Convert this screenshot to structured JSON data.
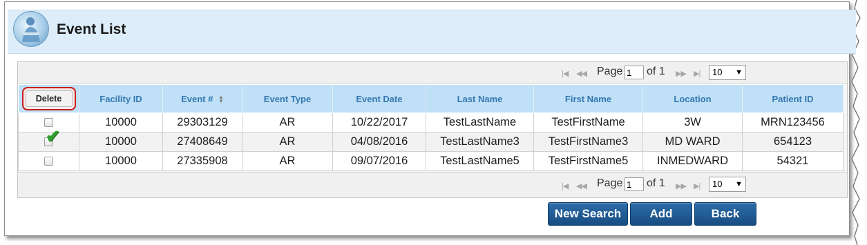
{
  "header": {
    "title": "Event List",
    "logo_icon": "clinician-icon"
  },
  "grid": {
    "pager": {
      "page_label": "Page",
      "page_value": "1",
      "of_label": "of 1",
      "page_size": "10"
    },
    "delete_label": "Delete",
    "columns": [
      "Facility ID",
      "Event #",
      "Event Type",
      "Event Date",
      "Last Name",
      "First Name",
      "Location",
      "Patient ID"
    ],
    "rows": [
      {
        "facility": "10000",
        "event": "29303129",
        "type": "AR",
        "date": "10/22/2017",
        "last": "TestLastName",
        "first": "TestFirstName",
        "location": "3W",
        "patient": "MRN123456",
        "checked": false
      },
      {
        "facility": "10000",
        "event": "27408649",
        "type": "AR",
        "date": "04/08/2016",
        "last": "TestLastName3",
        "first": "TestFirstName3",
        "location": "MD WARD",
        "patient": "654123",
        "checked": true
      },
      {
        "facility": "10000",
        "event": "27335908",
        "type": "AR",
        "date": "09/07/2016",
        "last": "TestLastName5",
        "first": "TestFirstName5",
        "location": "INMEDWARD",
        "patient": "54321",
        "checked": false
      }
    ]
  },
  "buttons": {
    "new_search": "New Search",
    "add": "Add",
    "back": "Back"
  },
  "colors": {
    "header_bg": "#ddeefa",
    "column_header_bg": "#bfe0f6",
    "button_bg": "#1f5c96",
    "highlight_circle": "#c81d1d",
    "check_mark": "#31a02e"
  }
}
